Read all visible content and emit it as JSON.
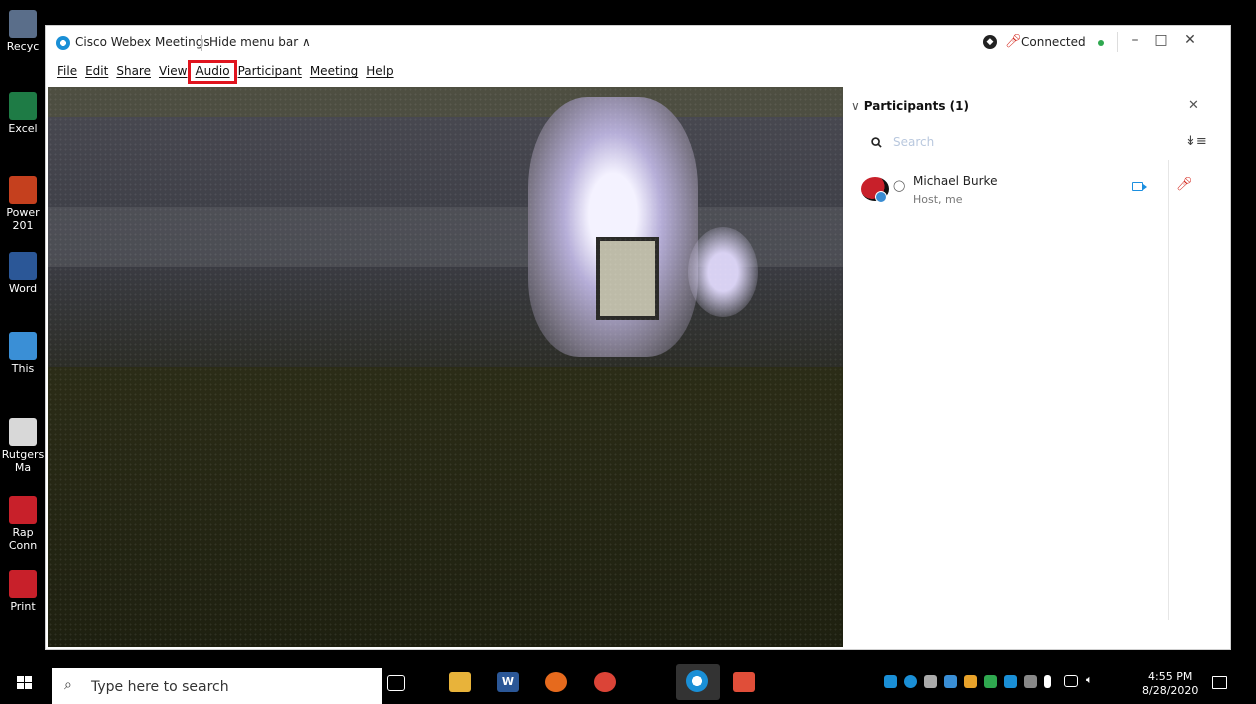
{
  "desktop": {
    "icons": [
      {
        "label": "Recyc",
        "name": "desktop-icon-recycle-bin",
        "color": "#5a6e8a"
      },
      {
        "label": "Excel",
        "name": "desktop-icon-excel",
        "color": "#1e7b45"
      },
      {
        "label": "Power 201",
        "name": "desktop-icon-powerpoint",
        "color": "#c5401e"
      },
      {
        "label": "Word",
        "name": "desktop-icon-word",
        "color": "#2b5797"
      },
      {
        "label": "This",
        "name": "desktop-icon-this-pc",
        "color": "#3a8fd6"
      },
      {
        "label": "Rutgers Ma",
        "name": "desktop-icon-rutgers",
        "color": "#d8d8d8"
      },
      {
        "label": "Rap Conn",
        "name": "desktop-icon-rapid-connect",
        "color": "#c8202a"
      },
      {
        "label": "Print",
        "name": "desktop-icon-print",
        "color": "#c8202a"
      }
    ]
  },
  "window": {
    "app_name": "Cisco Webex Meetings",
    "hide_menu": "Hide menu bar ∧",
    "status": "Connected",
    "status_color": "#2fa84f",
    "minimize": "–",
    "maximize": "□",
    "close": "✕",
    "outer_close": "✕"
  },
  "menu": [
    {
      "label": "File",
      "name": "menu-file"
    },
    {
      "label": "Edit",
      "name": "menu-edit"
    },
    {
      "label": "Share",
      "name": "menu-share"
    },
    {
      "label": "View",
      "name": "menu-view"
    },
    {
      "label": "Audio",
      "name": "menu-audio",
      "highlighted": true
    },
    {
      "label": "Participant",
      "name": "menu-participant"
    },
    {
      "label": "Meeting",
      "name": "menu-meeting"
    },
    {
      "label": "Help",
      "name": "menu-help"
    }
  ],
  "participants_panel": {
    "title": "Participants (1)",
    "chevron": "∨",
    "close": "✕",
    "search_placeholder": "Search",
    "sort": "↡≡",
    "participants": [
      {
        "name": "Michael Burke",
        "role": "Host, me"
      }
    ]
  },
  "taskbar": {
    "search_text": "Type here to search",
    "search_icon": "⌕",
    "time": "4:55 PM",
    "date": "8/28/2020"
  }
}
